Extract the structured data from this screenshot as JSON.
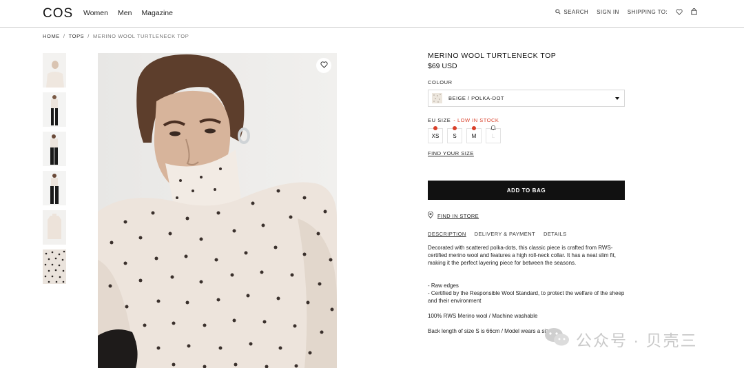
{
  "header": {
    "logo": "COS",
    "nav": [
      "Women",
      "Men",
      "Magazine"
    ],
    "search_label": "SEARCH",
    "sign_in_label": "SIGN IN",
    "shipping_label": "SHIPPING TO:"
  },
  "breadcrumb": [
    "HOME",
    "TOPS",
    "MERINO WOOL TURTLENECK TOP"
  ],
  "product": {
    "title": "MERINO WOOL TURTLENECK TOP",
    "price": "$69 USD",
    "colour_label": "COLOUR",
    "colour_value": "BEIGE / POLKA-DOT",
    "size_label": "EU SIZE",
    "stock_note": "- LOW IN STOCK",
    "sizes": [
      {
        "label": "XS",
        "low_stock": true,
        "available": true
      },
      {
        "label": "S",
        "low_stock": true,
        "available": true
      },
      {
        "label": "M",
        "low_stock": true,
        "available": true
      },
      {
        "label": "L",
        "low_stock": false,
        "available": false
      }
    ],
    "find_size_label": "FIND YOUR SIZE",
    "add_to_bag_label": "ADD TO BAG",
    "find_in_store_label": "FIND IN STORE",
    "tabs": [
      "DESCRIPTION",
      "DELIVERY & PAYMENT",
      "DETAILS"
    ],
    "active_tab": "DESCRIPTION",
    "description": {
      "intro": "Decorated with scattered polka-dots, this classic piece is crafted from RWS-certified merino wool and features a high roll-neck collar. It has a neat slim fit, making it the perfect layering piece for between the seasons.",
      "bullet_1": "- Raw edges",
      "bullet_2": "- Certified by the Responsible Wool Standard, to protect the welfare of the sheep and their environment",
      "composition": "100% RWS Merino wool / Machine washable",
      "fit_note": "Back length of size S is 66cm / Model wears a size S"
    }
  },
  "watermark": "公众号 · 贝壳三",
  "colors": {
    "accent_low_stock": "#d9402a",
    "button_bg": "#111111",
    "garment": "#ede4dc"
  }
}
